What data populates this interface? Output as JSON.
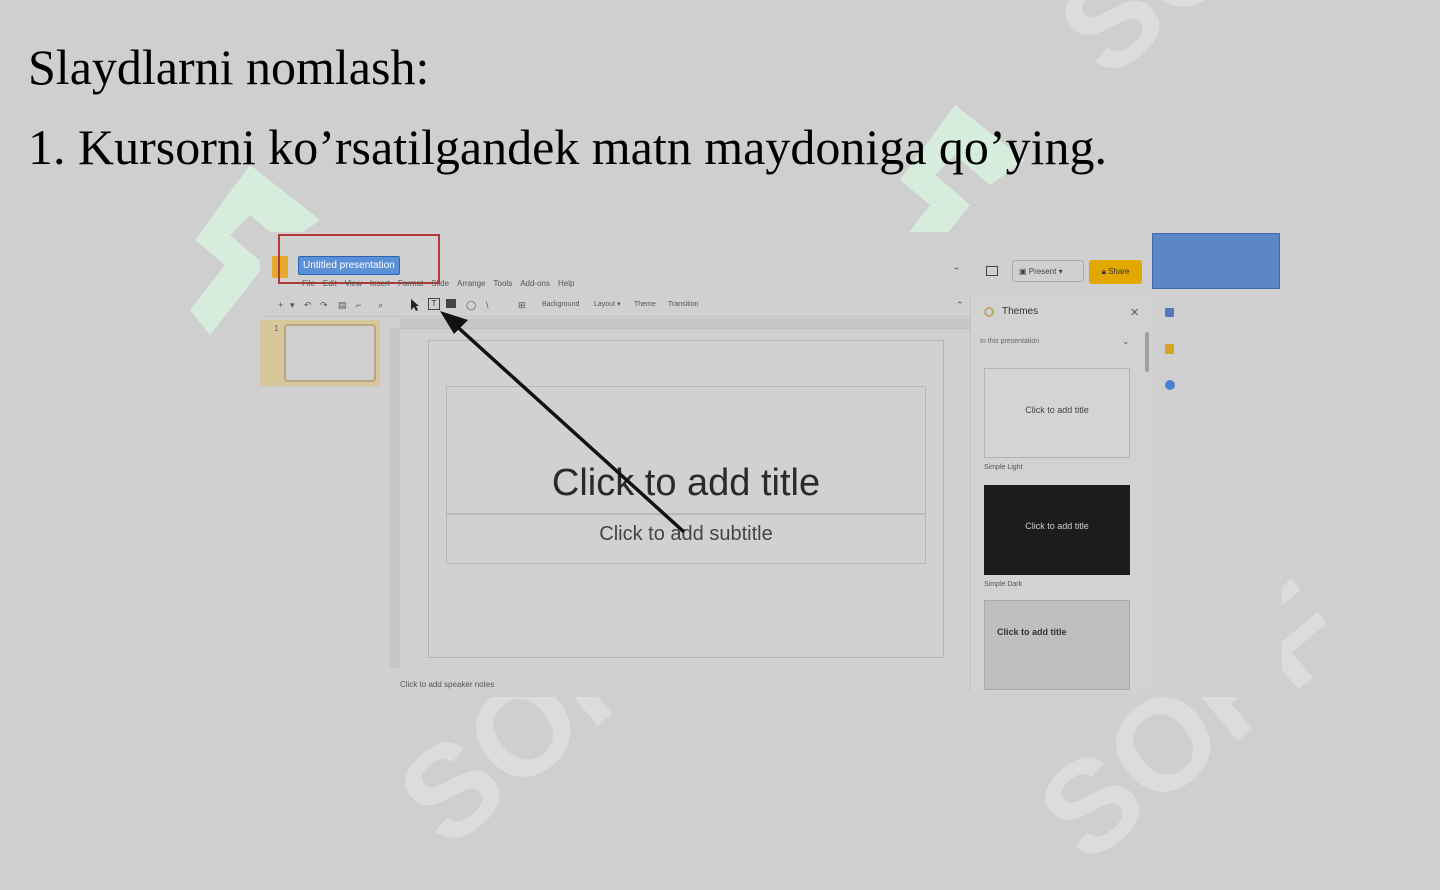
{
  "slide": {
    "heading": "Slaydlarni nomlash:",
    "step": "1. Kursorni ko’rsatilgandek matn maydoniga qo’ying."
  },
  "screenshot": {
    "title_input": "Untitled presentation",
    "menu": [
      "File",
      "Edit",
      "View",
      "Insert",
      "Format",
      "Slide",
      "Arrange",
      "Tools",
      "Add-ons",
      "Help"
    ],
    "toolbar": {
      "background": "Background",
      "layout": "Layout ▾",
      "theme": "Theme",
      "transition": "Transition"
    },
    "filmstrip": {
      "slide_number": "1"
    },
    "canvas": {
      "title_placeholder": "Click to add title",
      "subtitle_placeholder": "Click to add subtitle",
      "speaker_notes": "Click to add speaker notes"
    },
    "header_buttons": {
      "present": "Present",
      "share": "Share"
    },
    "themes_panel": {
      "title": "Themes",
      "filter": "In this presentation",
      "close": "✕",
      "themes": [
        {
          "name": "Simple Light",
          "preview_title": "Click to add title"
        },
        {
          "name": "Simple Dark",
          "preview_title": "Click to add title"
        },
        {
          "name": "",
          "preview_title": "Click to add title"
        }
      ]
    }
  },
  "watermark": {
    "text": "SOFF"
  },
  "colors": {
    "background": "#cfcfcf",
    "share_button": "#e3a800",
    "title_highlight": "#5b8fd6",
    "callout_border": "#b03a3a",
    "watermark": "#d6f0df"
  }
}
